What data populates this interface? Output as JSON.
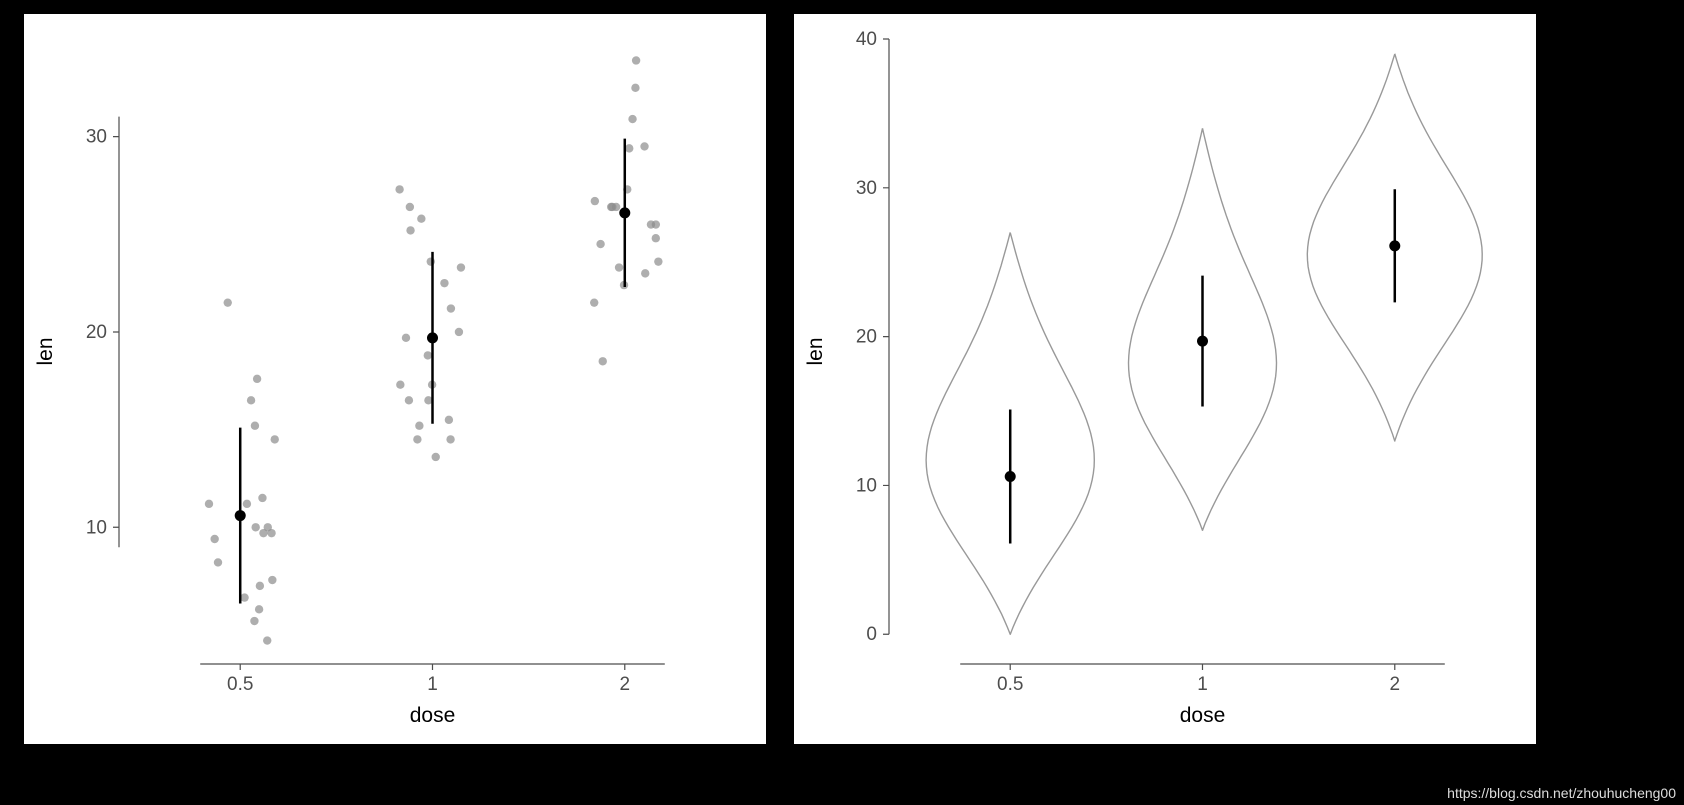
{
  "watermark": "https://blog.csdn.net/zhouhucheng00",
  "chart_data": [
    {
      "type": "scatter",
      "xlabel": "dose",
      "ylabel": "len",
      "xticks": [
        "0.5",
        "1",
        "2"
      ],
      "yticks": [
        10,
        20,
        30
      ],
      "ylim": [
        3,
        35
      ],
      "categories": [
        "0.5",
        "1",
        "2"
      ],
      "series": [
        {
          "name": "jitter-points",
          "data_by_category": {
            "0.5": [
              4.2,
              11.5,
              7.3,
              5.8,
              6.4,
              10.0,
              11.2,
              11.2,
              5.2,
              7.0,
              15.2,
              21.5,
              17.6,
              9.7,
              14.5,
              10.0,
              8.2,
              9.4,
              16.5,
              9.7
            ],
            "1": [
              16.5,
              16.5,
              15.2,
              17.3,
              22.5,
              17.3,
              13.6,
              14.5,
              18.8,
              15.5,
              19.7,
              23.3,
              23.6,
              26.4,
              20.0,
              25.2,
              25.8,
              21.2,
              14.5,
              27.3
            ],
            "2": [
              23.6,
              18.5,
              33.9,
              25.5,
              26.4,
              32.5,
              26.7,
              21.5,
              23.3,
              29.5,
              25.5,
              26.4,
              22.4,
              24.5,
              24.8,
              30.9,
              26.4,
              27.3,
              29.4,
              23.0
            ]
          }
        },
        {
          "name": "mean-sd",
          "summary": [
            {
              "category": "0.5",
              "mean": 10.6,
              "sd": 4.5
            },
            {
              "category": "1",
              "mean": 19.7,
              "sd": 4.4
            },
            {
              "category": "2",
              "mean": 26.1,
              "sd": 3.8
            }
          ]
        }
      ]
    },
    {
      "type": "violin",
      "xlabel": "dose",
      "ylabel": "len",
      "xticks": [
        "0.5",
        "1",
        "2"
      ],
      "yticks": [
        0,
        10,
        20,
        30,
        40
      ],
      "ylim": [
        -2,
        40
      ],
      "categories": [
        "0.5",
        "1",
        "2"
      ],
      "series": [
        {
          "name": "violin-density",
          "ranges": [
            {
              "category": "0.5",
              "min": 0,
              "max": 27,
              "mode_y": 10,
              "max_halfwidth": 0.42
            },
            {
              "category": "1",
              "min": 7,
              "max": 34,
              "mode_y": 16,
              "max_halfwidth": 0.38
            },
            {
              "category": "2",
              "min": 13,
              "max": 39,
              "mode_y": 25,
              "max_halfwidth": 0.42
            }
          ]
        },
        {
          "name": "mean-sd",
          "summary": [
            {
              "category": "0.5",
              "mean": 10.6,
              "sd": 4.5
            },
            {
              "category": "1",
              "mean": 19.7,
              "sd": 4.4
            },
            {
              "category": "2",
              "mean": 26.1,
              "sd": 3.8
            }
          ]
        }
      ]
    }
  ]
}
